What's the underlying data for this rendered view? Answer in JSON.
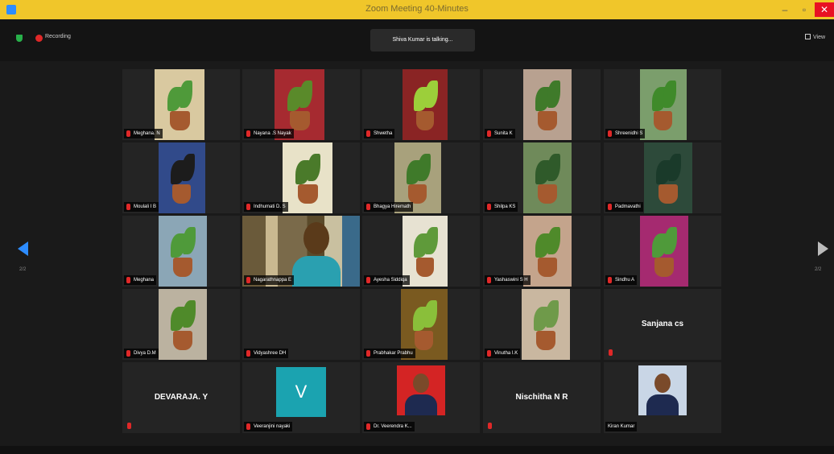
{
  "window": {
    "title": "Zoom Meeting 40-Minutes"
  },
  "topbar": {
    "recording_label": "Recording",
    "talking": "Shiva Kumar is talking...",
    "view_label": "View"
  },
  "pages": {
    "prev": "2/2",
    "next": "2/2"
  },
  "tiles": [
    {
      "name": "Meghana. N",
      "muted": true
    },
    {
      "name": "Nayana .S Nayak",
      "muted": true
    },
    {
      "name": "Shwetha",
      "muted": true
    },
    {
      "name": "Sunita K",
      "muted": true
    },
    {
      "name": "Shreenidhi S",
      "muted": true
    },
    {
      "name": "Moulali I B",
      "muted": true
    },
    {
      "name": "Indhumati D. S",
      "muted": true
    },
    {
      "name": "Bhagya Hiremath",
      "muted": true
    },
    {
      "name": "Shilpa KS",
      "muted": true
    },
    {
      "name": "Padmavathi",
      "muted": true
    },
    {
      "name": "Meghana",
      "muted": true
    },
    {
      "name": "Nagarathnappa E",
      "muted": true
    },
    {
      "name": "Ayesha Siddiqa",
      "muted": true
    },
    {
      "name": "Yashaswini S H",
      "muted": true
    },
    {
      "name": "Sindhu A",
      "muted": true
    },
    {
      "name": "Divya D.M",
      "muted": true
    },
    {
      "name": "Vidyashree DH",
      "muted": true
    },
    {
      "name": "Prabhakar Prabhu",
      "muted": true
    },
    {
      "name": "Vinutha I.K",
      "muted": true
    },
    {
      "name": "Sanjana cs",
      "muted": true
    },
    {
      "name": "DEVARAJA. Y",
      "muted": true
    },
    {
      "name": "Veeranjini nayaki",
      "muted": true,
      "initial": "V"
    },
    {
      "name": "Dr. Veerendra K...",
      "muted": true
    },
    {
      "name": "Nischitha N R",
      "muted": true
    },
    {
      "name": "Kiran Kumar",
      "muted": false
    }
  ],
  "colors": {
    "titlebar": "#f0c62a",
    "background": "#1a1a1a",
    "tile": "#242424",
    "accent": "#2d8cff",
    "muted": "#e02828",
    "avatar": "#1ba3b0"
  }
}
